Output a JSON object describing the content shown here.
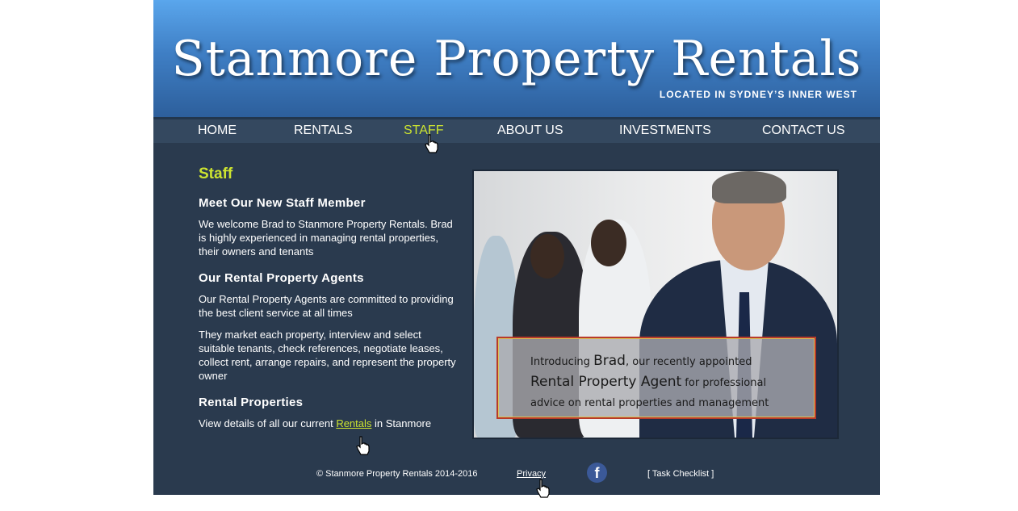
{
  "header": {
    "title": "Stanmore Property Rentals",
    "tagline": "LOCATED IN SYDNEY’S INNER WEST"
  },
  "nav": {
    "items": [
      {
        "label": "HOME"
      },
      {
        "label": "RENTALS"
      },
      {
        "label": "STAFF",
        "active": true
      },
      {
        "label": "ABOUT US"
      },
      {
        "label": "INVESTMENTS"
      },
      {
        "label": "CONTACT US"
      }
    ]
  },
  "main": {
    "page_title": "Staff",
    "sections": [
      {
        "heading": "Meet Our New Staff Member",
        "paragraphs": [
          "We welcome Brad to Stanmore Property Rentals. Brad is highly experienced in managing rental properties, their owners and tenants"
        ]
      },
      {
        "heading": "Our Rental Property Agents",
        "paragraphs": [
          "Our Rental Property Agents are committed to providing the best client service at all times",
          "They market each property, interview and select suitable tenants, check references, negotiate leases, collect rent, arrange repairs, and represent the property owner"
        ]
      },
      {
        "heading": "Rental Properties",
        "text_before_link": "View details of all our current",
        "link": "Rentals",
        "text_after_link": "in Stanmore"
      }
    ]
  },
  "photo": {
    "overlay_line1_a": "Introducing ",
    "overlay_line1_b": "Brad",
    "overlay_line1_c": ", our recently appointed",
    "overlay_line2_a": "Rental Property Agent",
    "overlay_line2_b": " for professional",
    "overlay_line3": "advice on rental properties and management"
  },
  "footer": {
    "copyright": "© Stanmore Property Rentals 2014-2016",
    "privacy": "Privacy",
    "facebook_icon": "f",
    "task_checklist": "[ Task Checklist ]"
  },
  "colors": {
    "accent": "#cde430",
    "page_bg": "#2a3a4e",
    "nav_bg": "#34485f",
    "facebook": "#3b5998"
  }
}
